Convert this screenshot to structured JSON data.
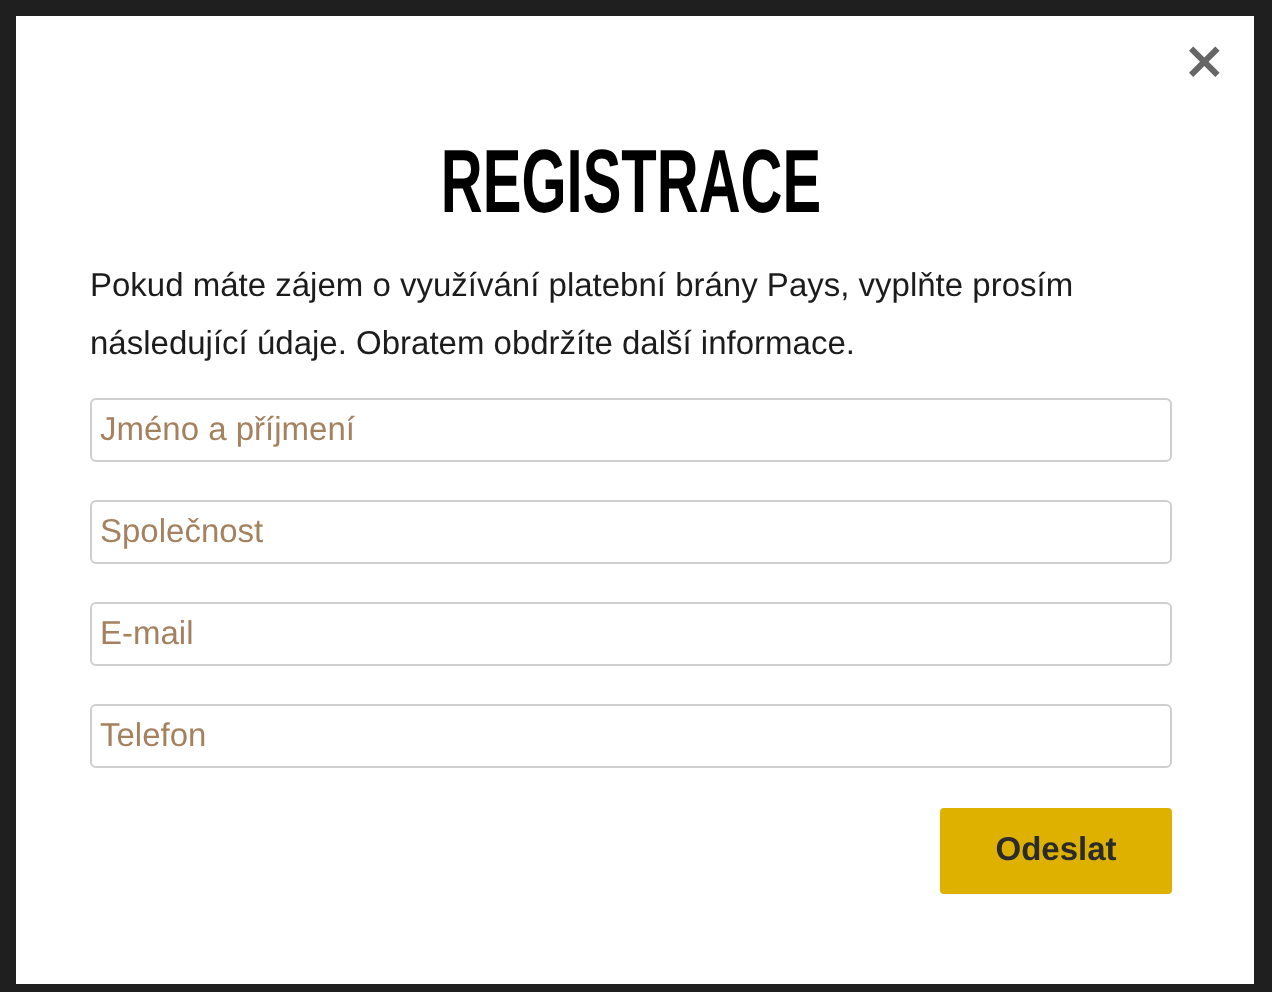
{
  "dialog": {
    "title": "REGISTRACE",
    "close": "×",
    "intro": "Pokud máte zájem o využívání platební brány Pays, vyplňte prosím následující údaje. Obratem obdržíte další informace.",
    "fields": [
      {
        "placeholder": "Jméno a příjmení"
      },
      {
        "placeholder": "Společnost"
      },
      {
        "placeholder": "E-mail"
      },
      {
        "placeholder": "Telefon"
      }
    ],
    "submit": "Odeslat"
  }
}
